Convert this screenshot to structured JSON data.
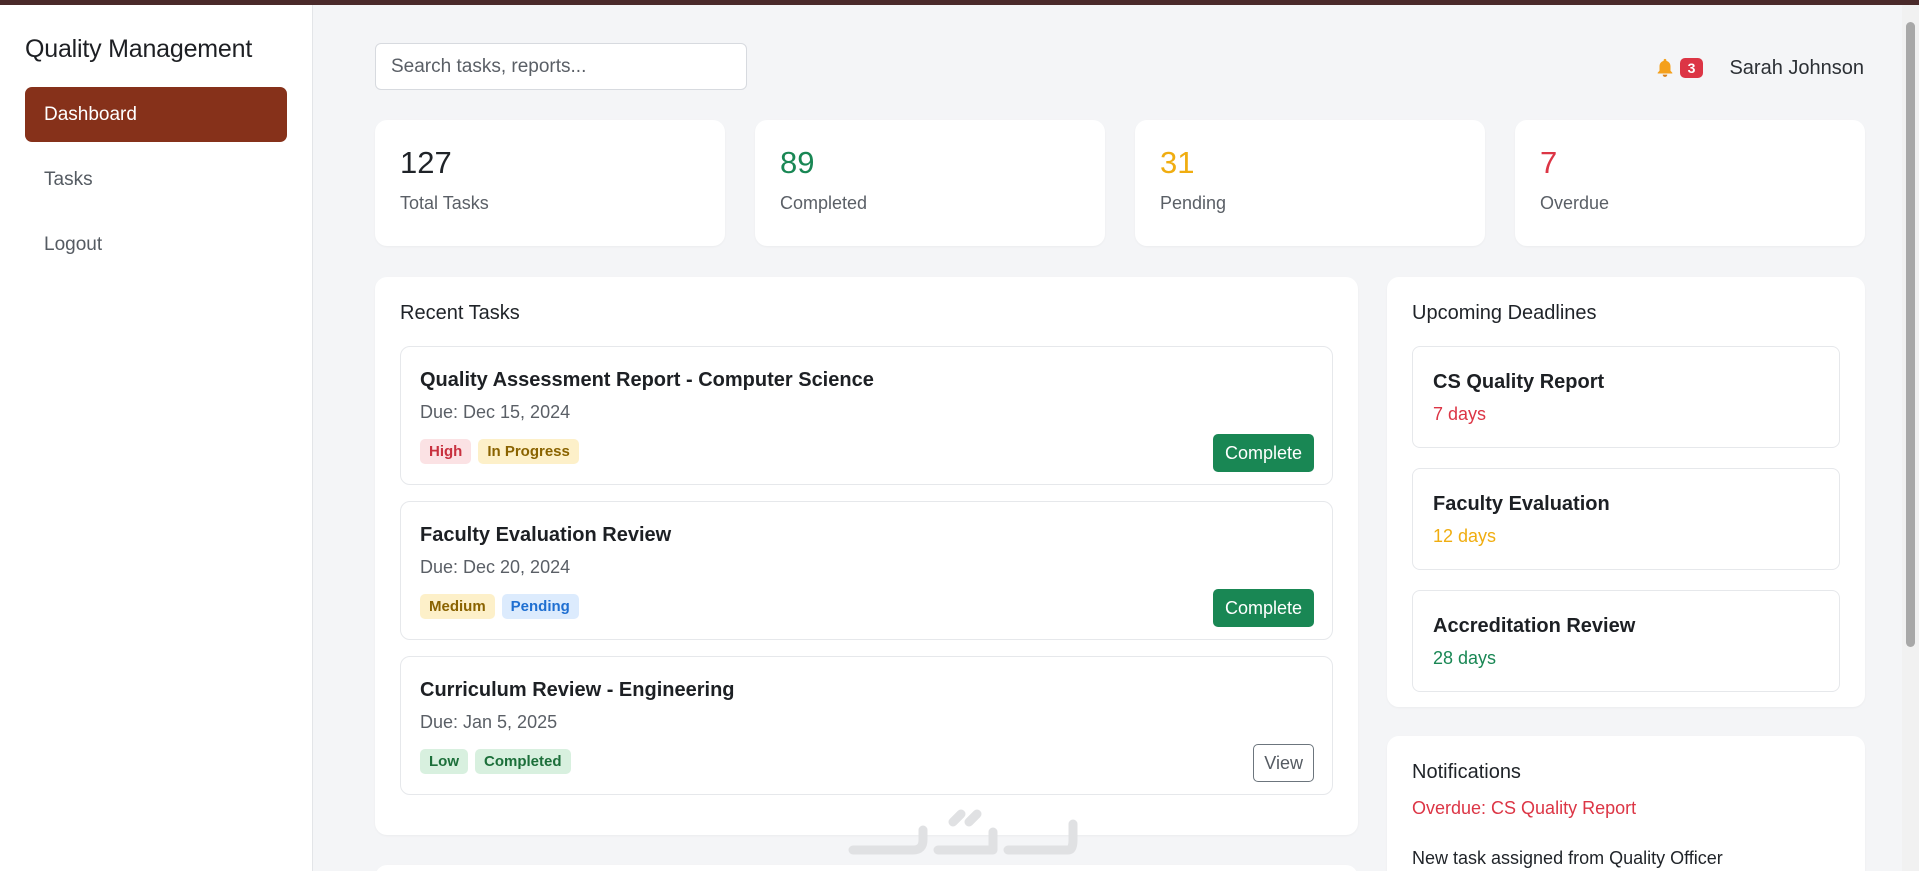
{
  "sidebar": {
    "title": "Quality Management",
    "items": [
      {
        "label": "Dashboard",
        "active": true
      },
      {
        "label": "Tasks",
        "active": false
      },
      {
        "label": "Logout",
        "active": false
      }
    ]
  },
  "header": {
    "search_placeholder": "Search tasks, reports...",
    "notification_count": "3",
    "user_name": "Sarah Johnson",
    "bell_icon": "bell-icon"
  },
  "stats": [
    {
      "value": "127",
      "label": "Total Tasks",
      "color": "#1f2328"
    },
    {
      "value": "89",
      "label": "Completed",
      "color": "#198754"
    },
    {
      "value": "31",
      "label": "Pending",
      "color": "#f0ad10"
    },
    {
      "value": "7",
      "label": "Overdue",
      "color": "#dc3545"
    }
  ],
  "recent_tasks": {
    "title": "Recent Tasks",
    "items": [
      {
        "title": "Quality Assessment Report - Computer Science",
        "due": "Due: Dec 15, 2024",
        "priority": "High",
        "status": "In Progress",
        "action": "Complete"
      },
      {
        "title": "Faculty Evaluation Review",
        "due": "Due: Dec 20, 2024",
        "priority": "Medium",
        "status": "Pending",
        "action": "Complete"
      },
      {
        "title": "Curriculum Review - Engineering",
        "due": "Due: Jan 5, 2025",
        "priority": "Low",
        "status": "Completed",
        "action": "View"
      }
    ]
  },
  "deadlines": {
    "title": "Upcoming Deadlines",
    "items": [
      {
        "title": "CS Quality Report",
        "days": "7 days",
        "color": "#dc3545"
      },
      {
        "title": "Faculty Evaluation",
        "days": "12 days",
        "color": "#f0ad10"
      },
      {
        "title": "Accreditation Review",
        "days": "28 days",
        "color": "#198754"
      }
    ]
  },
  "notifications": {
    "title": "Notifications",
    "items": [
      {
        "text": "Overdue: CS Quality Report",
        "color": "#dc3545"
      },
      {
        "text": "New task assigned from Quality Officer",
        "color": "#1f2328"
      }
    ]
  },
  "colors": {
    "accent": "#86311a",
    "success": "#198754",
    "warning": "#f0ad10",
    "danger": "#dc3545"
  }
}
